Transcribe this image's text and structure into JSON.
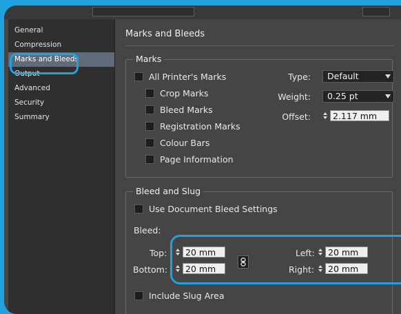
{
  "sidebar": {
    "items": [
      {
        "label": "General"
      },
      {
        "label": "Compression"
      },
      {
        "label": "Marks and Bleeds"
      },
      {
        "label": "Output"
      },
      {
        "label": "Advanced"
      },
      {
        "label": "Security"
      },
      {
        "label": "Summary"
      }
    ],
    "selected_index": 2
  },
  "main": {
    "title": "Marks and Bleeds",
    "marks": {
      "title": "Marks",
      "all_printers_marks": "All Printer's Marks",
      "crop_marks": "Crop Marks",
      "bleed_marks": "Bleed Marks",
      "registration_marks": "Registration Marks",
      "colour_bars": "Colour Bars",
      "page_information": "Page Information",
      "type_label": "Type:",
      "type_value": "Default",
      "weight_label": "Weight:",
      "weight_value": "0.25 pt",
      "offset_label": "Offset:",
      "offset_value": "2.117 mm"
    },
    "bleed_slug": {
      "title": "Bleed and Slug",
      "use_document": "Use Document Bleed Settings",
      "bleed_label": "Bleed:",
      "top_label": "Top:",
      "top_value": "20 mm",
      "bottom_label": "Bottom:",
      "bottom_value": "20 mm",
      "left_label": "Left:",
      "left_value": "20 mm",
      "right_label": "Right:",
      "right_value": "20 mm",
      "include_slug": "Include Slug Area"
    }
  },
  "colors": {
    "accent": "#1fa2dd",
    "panel": "#454545",
    "sidebar": "#2f2f2f",
    "selected": "#5f6b7a"
  },
  "icons": {
    "chain": "chain-link-icon",
    "dropdown": "chevron-down-icon",
    "spinner": "spinner-arrows-icon"
  }
}
